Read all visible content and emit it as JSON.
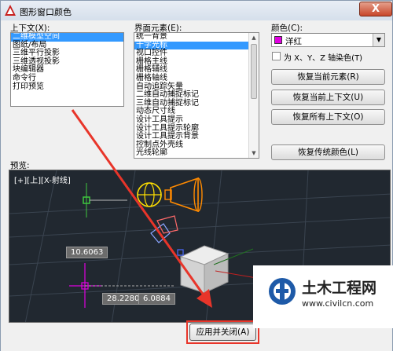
{
  "window": {
    "title": "图形窗口颜色",
    "close_label": "X"
  },
  "context": {
    "label": "上下文(X):",
    "items": [
      "二维模型空间",
      "图纸/布局",
      "三维平行投影",
      "三维透视投影",
      "块编辑器",
      "命令行",
      "打印预览"
    ],
    "selected_index": 0
  },
  "interface": {
    "label": "界面元素(E):",
    "items": [
      "统一背景",
      "十字光标",
      "视口控件",
      "栅格主线",
      "栅格辅线",
      "栅格轴线",
      "自动追踪矢量",
      "二维自动捕捉标记",
      "三维自动捕捉标记",
      "动态尺寸线",
      "设计工具提示",
      "设计工具提示轮廓",
      "设计工具提示背景",
      "控制点外壳线",
      "光线轮廓"
    ],
    "selected_index": 1
  },
  "color": {
    "label": "颜色(C):",
    "value": "洋红",
    "swatch": "#e000e0",
    "tint_label": "为 X、Y、Z 轴染色(T)"
  },
  "buttons": {
    "restore_element": "恢复当前元素(R)",
    "restore_context": "恢复当前上下文(U)",
    "restore_all": "恢复所有上下文(O)",
    "restore_classic": "恢复传统颜色(L)",
    "apply_close": "应用并关闭(A)"
  },
  "preview": {
    "label": "预览:",
    "viewport_label": "[+][上][X-射线]",
    "dim_1": "10.6063",
    "dim_2": "28.2280",
    "dim_3": "6.0884"
  },
  "watermark": {
    "brand": "土木工程网",
    "url": "www.civilcn.com",
    "accent": "#1e5aa8"
  }
}
